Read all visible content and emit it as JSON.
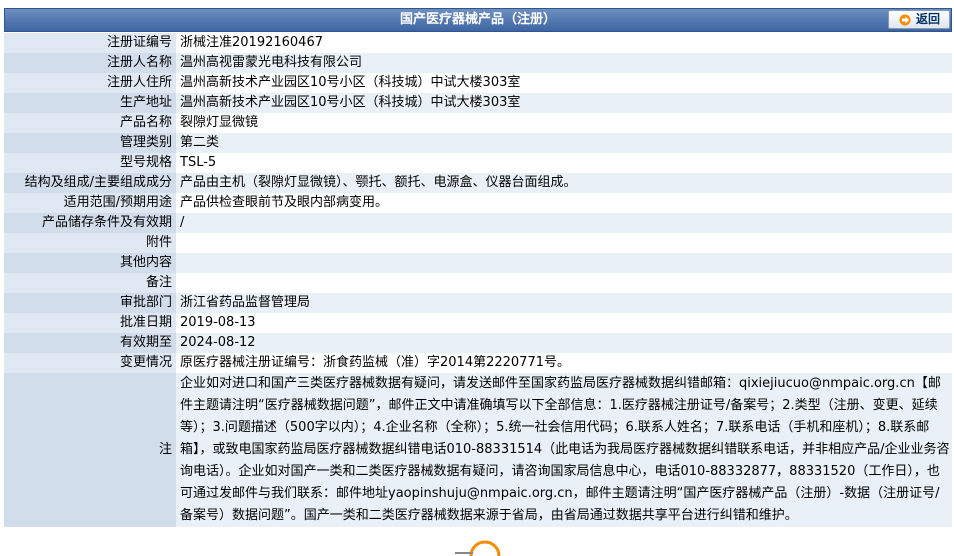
{
  "header": {
    "title": "国产医疗器械产品（注册）",
    "back_label": "返回"
  },
  "rows": [
    {
      "label": "注册证编号",
      "value": "浙械注准20192160467"
    },
    {
      "label": "注册人名称",
      "value": "温州高视雷蒙光电科技有限公司"
    },
    {
      "label": "注册人住所",
      "value": "温州高新技术产业园区10号小区（科技城）中试大楼303室"
    },
    {
      "label": "生产地址",
      "value": "温州高新技术产业园区10号小区（科技城）中试大楼303室"
    },
    {
      "label": "产品名称",
      "value": "裂隙灯显微镜"
    },
    {
      "label": "管理类别",
      "value": "第二类"
    },
    {
      "label": "型号规格",
      "value": "TSL-5"
    },
    {
      "label": "结构及组成/主要组成成分",
      "value": "产品由主机（裂隙灯显微镜）、颚托、额托、电源盒、仪器台面组成。"
    },
    {
      "label": "适用范围/预期用途",
      "value": "产品供检查眼前节及眼内部病变用。"
    },
    {
      "label": "产品储存条件及有效期",
      "value": "/"
    },
    {
      "label": "附件",
      "value": ""
    },
    {
      "label": "其他内容",
      "value": ""
    },
    {
      "label": "备注",
      "value": ""
    },
    {
      "label": "审批部门",
      "value": "浙江省药品监督管理局"
    },
    {
      "label": "批准日期",
      "value": "2019-08-13"
    },
    {
      "label": "有效期至",
      "value": "2024-08-12"
    },
    {
      "label": "变更情况",
      "value": "原医疗器械注册证编号：浙食药监械（准）字2014第2220771号。"
    }
  ],
  "note": {
    "label": "注",
    "value": "企业如对进口和国产三类医疗器械数据有疑问，请发送邮件至国家药监局医疗器械数据纠错邮箱：qixiejiucuo@nmpaic.org.cn【邮件主题请注明“医疗器械数据问题”，邮件正文中请准确填写以下全部信息：1.医疗器械注册证号/备案号；2.类型（注册、变更、延续等）；3.问题描述（500字以内）；4.企业名称（全称）；5.统一社会信用代码；6.联系人姓名；7.联系电话（手机和座机）；8.联系邮箱】，或致电国家药监局医疗器械数据纠错电话010-88331514（此电话为我局医疗器械数据纠错联系电话，并非相应产品/企业业务咨询电话）。企业如对国产一类和二类医疗器械数据有疑问，请咨询国家局信息中心，电话010-88332877，88331520（工作日），也可通过发邮件与我们联系：邮件地址yaopinshuju@nmpaic.org.cn，邮件主题请注明“国产医疗器械产品（注册）-数据（注册证号/备案号）数据问题”。国产一类和二类医疗器械数据来源于省局，由省局通过数据共享平台进行纠错和维护。"
  },
  "colors": {
    "header_bg": "#3e65a3",
    "label_bg": "#dfe8f3",
    "stripe_bg": "#eaf0f7",
    "accent": "#f28c00"
  }
}
